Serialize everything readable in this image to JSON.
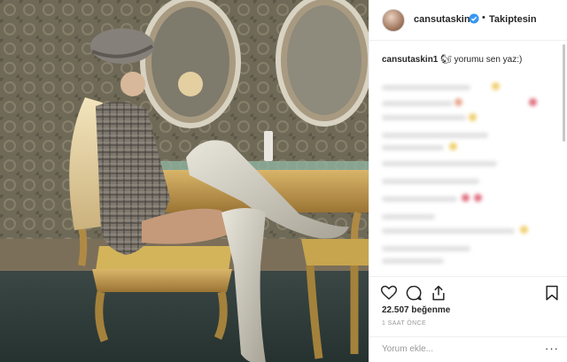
{
  "post": {
    "username": "cansutaskin1",
    "follow_status": "Takiptesin",
    "separator": "•",
    "caption_username": "cansutaskin1",
    "caption_emoji": "🐿",
    "caption_text": "yorumu sen yaz:)",
    "likes_count": "22.507",
    "likes_label": "beğenme",
    "timestamp": "1 SAAT ÖNCE",
    "comment_placeholder": "Yorum ekle...",
    "more_label": "···"
  },
  "icons": {
    "like": "heart-icon",
    "comment": "comment-icon",
    "share": "share-icon",
    "save": "bookmark-icon",
    "verified": "verified-badge-icon"
  },
  "colors": {
    "text": "#262626",
    "muted": "#999999",
    "verified": "#3897f0",
    "border": "#efefef"
  }
}
